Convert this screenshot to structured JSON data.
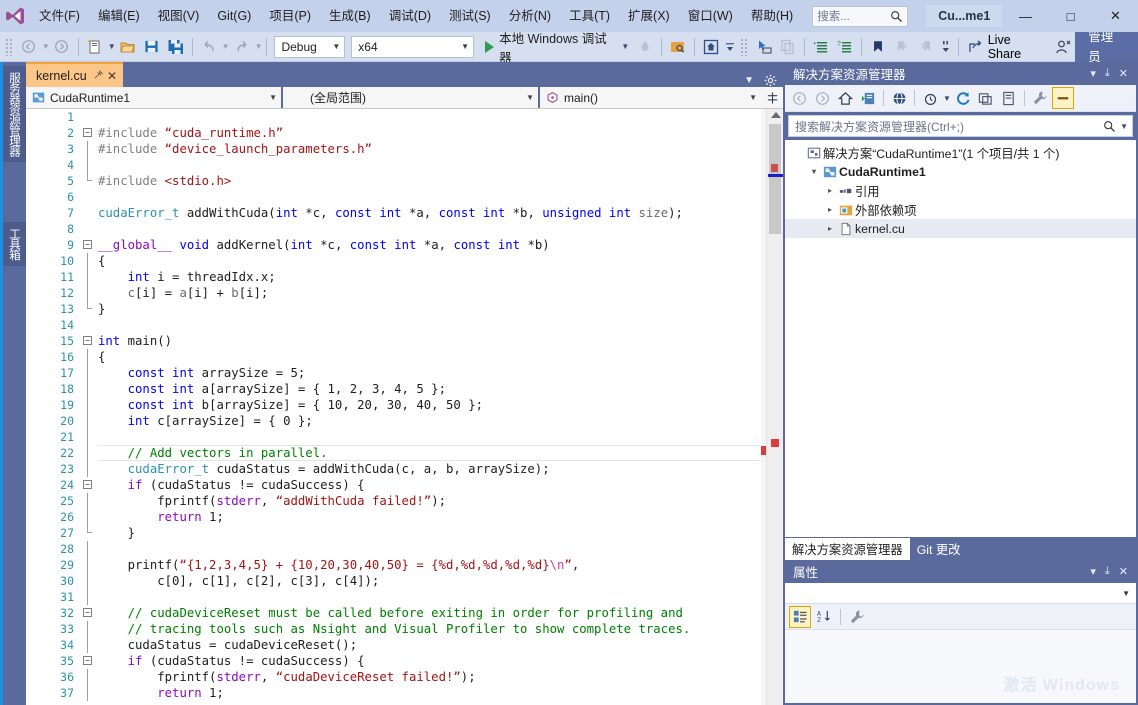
{
  "window": {
    "title": "Cu...me1",
    "minimize_label": "—",
    "maximize_label": "□",
    "close_label": "✕"
  },
  "menubar": {
    "logo_name": "visual-studio-logo",
    "items": [
      {
        "label": "文件(F)"
      },
      {
        "label": "编辑(E)"
      },
      {
        "label": "视图(V)"
      },
      {
        "label": "Git(G)"
      },
      {
        "label": "项目(P)"
      },
      {
        "label": "生成(B)"
      },
      {
        "label": "调试(D)"
      },
      {
        "label": "测试(S)"
      },
      {
        "label": "分析(N)"
      },
      {
        "label": "工具(T)"
      },
      {
        "label": "扩展(X)"
      },
      {
        "label": "窗口(W)"
      },
      {
        "label": "帮助(H)"
      }
    ],
    "search_placeholder": "搜索..."
  },
  "toolbar": {
    "nav_back": "◀",
    "nav_forward": "▶",
    "new_project_label": "new-project",
    "open_file_label": "open-file",
    "save_label": "save",
    "save_all_label": "save-all",
    "undo_label": "undo",
    "redo_label": "redo",
    "config_combo": "Debug",
    "platform_combo": "x64",
    "run_label": "本地 Windows 调试器",
    "live_share_label": "Live Share",
    "admin_label": "管理员"
  },
  "left_strip": {
    "tabs": [
      {
        "label": "服务器资源管理器"
      },
      {
        "label": "工具箱"
      }
    ]
  },
  "editor": {
    "tab_label": "kernel.cu",
    "pin_glyph": "⤒",
    "close_glyph": "✕",
    "nav_project": "CudaRuntime1",
    "nav_scope": "(全局范围)",
    "nav_member": "main()",
    "lines": [
      {
        "n": 1,
        "tokens": []
      },
      {
        "n": 2,
        "fold": "minus",
        "tokens": [
          {
            "c": "pre",
            "t": "#include "
          },
          {
            "c": "str",
            "t": "“cuda_runtime.h”"
          }
        ]
      },
      {
        "n": 3,
        "fold": "bar",
        "tokens": [
          {
            "c": "pre",
            "t": "#include "
          },
          {
            "c": "str",
            "t": "“device_launch_parameters.h”"
          }
        ]
      },
      {
        "n": 4,
        "fold": "bar",
        "tokens": []
      },
      {
        "n": 5,
        "fold": "barend",
        "tokens": [
          {
            "c": "pre",
            "t": "#include "
          },
          {
            "c": "str",
            "t": "<stdio.h>"
          }
        ]
      },
      {
        "n": 6,
        "tokens": []
      },
      {
        "n": 7,
        "tokens": [
          {
            "c": "typ",
            "t": "cudaError_t"
          },
          {
            "c": "pln",
            "t": " addWithCuda("
          },
          {
            "c": "kw",
            "t": "int"
          },
          {
            "c": "pln",
            "t": " *c, "
          },
          {
            "c": "kw",
            "t": "const int"
          },
          {
            "c": "pln",
            "t": " *a, "
          },
          {
            "c": "kw",
            "t": "const int"
          },
          {
            "c": "pln",
            "t": " *b, "
          },
          {
            "c": "kw",
            "t": "unsigned int"
          },
          {
            "c": "id",
            "t": " size"
          },
          {
            "c": "pln",
            "t": ");"
          }
        ]
      },
      {
        "n": 8,
        "tokens": []
      },
      {
        "n": 9,
        "fold": "minus",
        "tokens": [
          {
            "c": "kw2",
            "t": "__global__"
          },
          {
            "c": "kw",
            "t": " void"
          },
          {
            "c": "pln",
            "t": " addKernel("
          },
          {
            "c": "kw",
            "t": "int"
          },
          {
            "c": "pln",
            "t": " *c, "
          },
          {
            "c": "kw",
            "t": "const int"
          },
          {
            "c": "pln",
            "t": " *a, "
          },
          {
            "c": "kw",
            "t": "const int"
          },
          {
            "c": "pln",
            "t": " *b)"
          }
        ]
      },
      {
        "n": 10,
        "fold": "bar",
        "tokens": [
          {
            "c": "pln",
            "t": "{"
          }
        ]
      },
      {
        "n": 11,
        "fold": "dash",
        "tokens": [
          {
            "c": "pln",
            "t": "    "
          },
          {
            "c": "kw",
            "t": "int"
          },
          {
            "c": "pln",
            "t": " i = threadIdx.x;"
          }
        ]
      },
      {
        "n": 12,
        "fold": "dash",
        "tokens": [
          {
            "c": "pln",
            "t": "    "
          },
          {
            "c": "id",
            "t": "c"
          },
          {
            "c": "pln",
            "t": "[i] = "
          },
          {
            "c": "id",
            "t": "a"
          },
          {
            "c": "pln",
            "t": "[i] + "
          },
          {
            "c": "id",
            "t": "b"
          },
          {
            "c": "pln",
            "t": "[i];"
          }
        ]
      },
      {
        "n": 13,
        "fold": "barend",
        "tokens": [
          {
            "c": "pln",
            "t": "}"
          }
        ]
      },
      {
        "n": 14,
        "tokens": []
      },
      {
        "n": 15,
        "fold": "minus",
        "tokens": [
          {
            "c": "kw",
            "t": "int"
          },
          {
            "c": "pln",
            "t": " main()"
          }
        ]
      },
      {
        "n": 16,
        "fold": "bar",
        "tokens": [
          {
            "c": "pln",
            "t": "{"
          }
        ]
      },
      {
        "n": 17,
        "fold": "dash",
        "tokens": [
          {
            "c": "pln",
            "t": "    "
          },
          {
            "c": "kw",
            "t": "const int"
          },
          {
            "c": "pln",
            "t": " arraySize = 5;"
          }
        ]
      },
      {
        "n": 18,
        "fold": "dash",
        "tokens": [
          {
            "c": "pln",
            "t": "    "
          },
          {
            "c": "kw",
            "t": "const int"
          },
          {
            "c": "pln",
            "t": " a[arraySize] = { 1, 2, 3, 4, 5 };"
          }
        ]
      },
      {
        "n": 19,
        "fold": "dash",
        "tokens": [
          {
            "c": "pln",
            "t": "    "
          },
          {
            "c": "kw",
            "t": "const int"
          },
          {
            "c": "pln",
            "t": " b[arraySize] = { 10, 20, 30, 40, 50 };"
          }
        ]
      },
      {
        "n": 20,
        "fold": "dash",
        "tokens": [
          {
            "c": "pln",
            "t": "    "
          },
          {
            "c": "kw",
            "t": "int"
          },
          {
            "c": "pln",
            "t": " c[arraySize] = { 0 };"
          }
        ]
      },
      {
        "n": 21,
        "fold": "dash",
        "tokens": []
      },
      {
        "n": 22,
        "fold": "dash",
        "current": true,
        "tokens": [
          {
            "c": "pln",
            "t": "    "
          },
          {
            "c": "cmt",
            "t": "// Add vectors in parallel."
          }
        ]
      },
      {
        "n": 23,
        "fold": "dash",
        "tokens": [
          {
            "c": "pln",
            "t": "    "
          },
          {
            "c": "typ",
            "t": "cudaError_t"
          },
          {
            "c": "pln",
            "t": " cudaStatus = addWithCuda(c, a, b, arraySize);"
          }
        ]
      },
      {
        "n": 24,
        "fold": "minus2",
        "tokens": [
          {
            "c": "pln",
            "t": "    "
          },
          {
            "c": "kw2",
            "t": "if"
          },
          {
            "c": "pln",
            "t": " (cudaStatus != cudaSuccess) {"
          }
        ]
      },
      {
        "n": 25,
        "fold": "dash2",
        "tokens": [
          {
            "c": "pln",
            "t": "        fprintf("
          },
          {
            "c": "kw2",
            "t": "stderr"
          },
          {
            "c": "pln",
            "t": ", "
          },
          {
            "c": "str",
            "t": "“addWithCuda failed!”"
          },
          {
            "c": "pln",
            "t": ");"
          }
        ]
      },
      {
        "n": 26,
        "fold": "dash2",
        "tokens": [
          {
            "c": "pln",
            "t": "        "
          },
          {
            "c": "kw2",
            "t": "return"
          },
          {
            "c": "pln",
            "t": " 1;"
          }
        ]
      },
      {
        "n": 27,
        "fold": "barend2",
        "tokens": [
          {
            "c": "pln",
            "t": "    }"
          }
        ]
      },
      {
        "n": 28,
        "fold": "dash",
        "tokens": []
      },
      {
        "n": 29,
        "fold": "dash",
        "tokens": [
          {
            "c": "pln",
            "t": "    printf("
          },
          {
            "c": "str",
            "t": "“{1,2,3,4,5} + {10,20,30,40,50} = {%d,%d,%d,%d,%d}"
          },
          {
            "c": "esc",
            "t": "\\n"
          },
          {
            "c": "str",
            "t": "”"
          },
          {
            "c": "pln",
            "t": ","
          }
        ]
      },
      {
        "n": 30,
        "fold": "dash",
        "tokens": [
          {
            "c": "pln",
            "t": "        c[0], c[1], c[2], c[3], c[4]);"
          }
        ]
      },
      {
        "n": 31,
        "fold": "dash",
        "tokens": []
      },
      {
        "n": 32,
        "fold": "minus2",
        "tokens": [
          {
            "c": "pln",
            "t": "    "
          },
          {
            "c": "cmt",
            "t": "// cudaDeviceReset must be called before exiting in order for profiling and"
          }
        ]
      },
      {
        "n": 33,
        "fold": "dash2",
        "tokens": [
          {
            "c": "pln",
            "t": "    "
          },
          {
            "c": "cmt",
            "t": "// tracing tools such as Nsight and Visual Profiler to show complete traces."
          }
        ]
      },
      {
        "n": 34,
        "fold": "dash",
        "tokens": [
          {
            "c": "pln",
            "t": "    cudaStatus = cudaDeviceReset();"
          }
        ]
      },
      {
        "n": 35,
        "fold": "minus2",
        "tokens": [
          {
            "c": "pln",
            "t": "    "
          },
          {
            "c": "kw2",
            "t": "if"
          },
          {
            "c": "pln",
            "t": " (cudaStatus != cudaSuccess) {"
          }
        ]
      },
      {
        "n": 36,
        "fold": "dash2",
        "tokens": [
          {
            "c": "pln",
            "t": "        fprintf("
          },
          {
            "c": "kw2",
            "t": "stderr"
          },
          {
            "c": "pln",
            "t": ", "
          },
          {
            "c": "str",
            "t": "“cudaDeviceReset failed!”"
          },
          {
            "c": "pln",
            "t": ");"
          }
        ]
      },
      {
        "n": 37,
        "fold": "dash2",
        "tokens": [
          {
            "c": "pln",
            "t": "        "
          },
          {
            "c": "kw2",
            "t": "return"
          },
          {
            "c": "pln",
            "t": " 1;"
          }
        ]
      }
    ]
  },
  "solution_explorer": {
    "title": "解决方案资源管理器",
    "dropdown_glyph": "▾",
    "pin_glyph": "⤓",
    "close_glyph": "✕",
    "search_placeholder": "搜索解决方案资源管理器(Ctrl+;)",
    "tree": [
      {
        "indent": 0,
        "expander": "",
        "icon": "solution-icon",
        "label": "解决方案“CudaRuntime1”(1 个项目/共 1 个)",
        "bold": false
      },
      {
        "indent": 1,
        "expander": "▾",
        "icon": "project-icon",
        "label": "CudaRuntime1",
        "bold": true
      },
      {
        "indent": 2,
        "expander": "▸",
        "icon": "references-icon",
        "label": "引用",
        "bold": false
      },
      {
        "indent": 2,
        "expander": "▸",
        "icon": "folder-icon",
        "label": "外部依赖项",
        "bold": false
      },
      {
        "indent": 2,
        "expander": "▸",
        "icon": "file-icon",
        "label": "kernel.cu",
        "bold": false,
        "selected": true
      }
    ],
    "dock_tabs": [
      {
        "label": "解决方案资源管理器",
        "active": true
      },
      {
        "label": "Git 更改",
        "active": false
      }
    ]
  },
  "properties": {
    "title": "属性",
    "dropdown_glyph": "▾",
    "pin_glyph": "⤓",
    "close_glyph": "✕",
    "combo_value": "",
    "watermark": "激活 Windows"
  },
  "colors": {
    "menubar_bg": "#c3d1ea",
    "toolbar_bg": "#d6dff0",
    "dock_bg": "#5b6a9c",
    "accent_blue": "#1f8fe0",
    "tab_active": "#fdc689",
    "admin_badge": "#5a6ea5",
    "string": "#a31515",
    "comment": "#008000",
    "keyword": "#0000ff",
    "type": "#2b91af",
    "preproc": "#808080"
  }
}
